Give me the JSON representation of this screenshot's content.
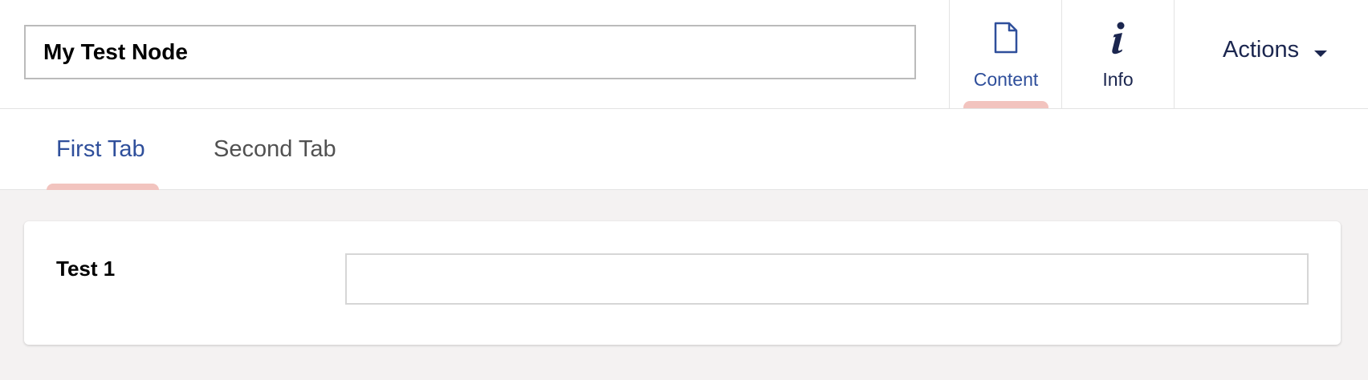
{
  "header": {
    "node_name": "My Test Node",
    "apps": [
      {
        "label": "Content",
        "icon": "document-icon",
        "active": true
      },
      {
        "label": "Info",
        "icon": "info-icon",
        "active": false
      }
    ],
    "actions_label": "Actions"
  },
  "tabs": [
    {
      "label": "First Tab",
      "active": true
    },
    {
      "label": "Second Tab",
      "active": false
    }
  ],
  "properties": [
    {
      "label": "Test 1",
      "value": ""
    }
  ],
  "colors": {
    "accent_blue": "#2f4f9b",
    "dark_navy": "#1b264f",
    "indicator_pink": "#f2c4bf",
    "page_background": "#f4f2f2"
  }
}
